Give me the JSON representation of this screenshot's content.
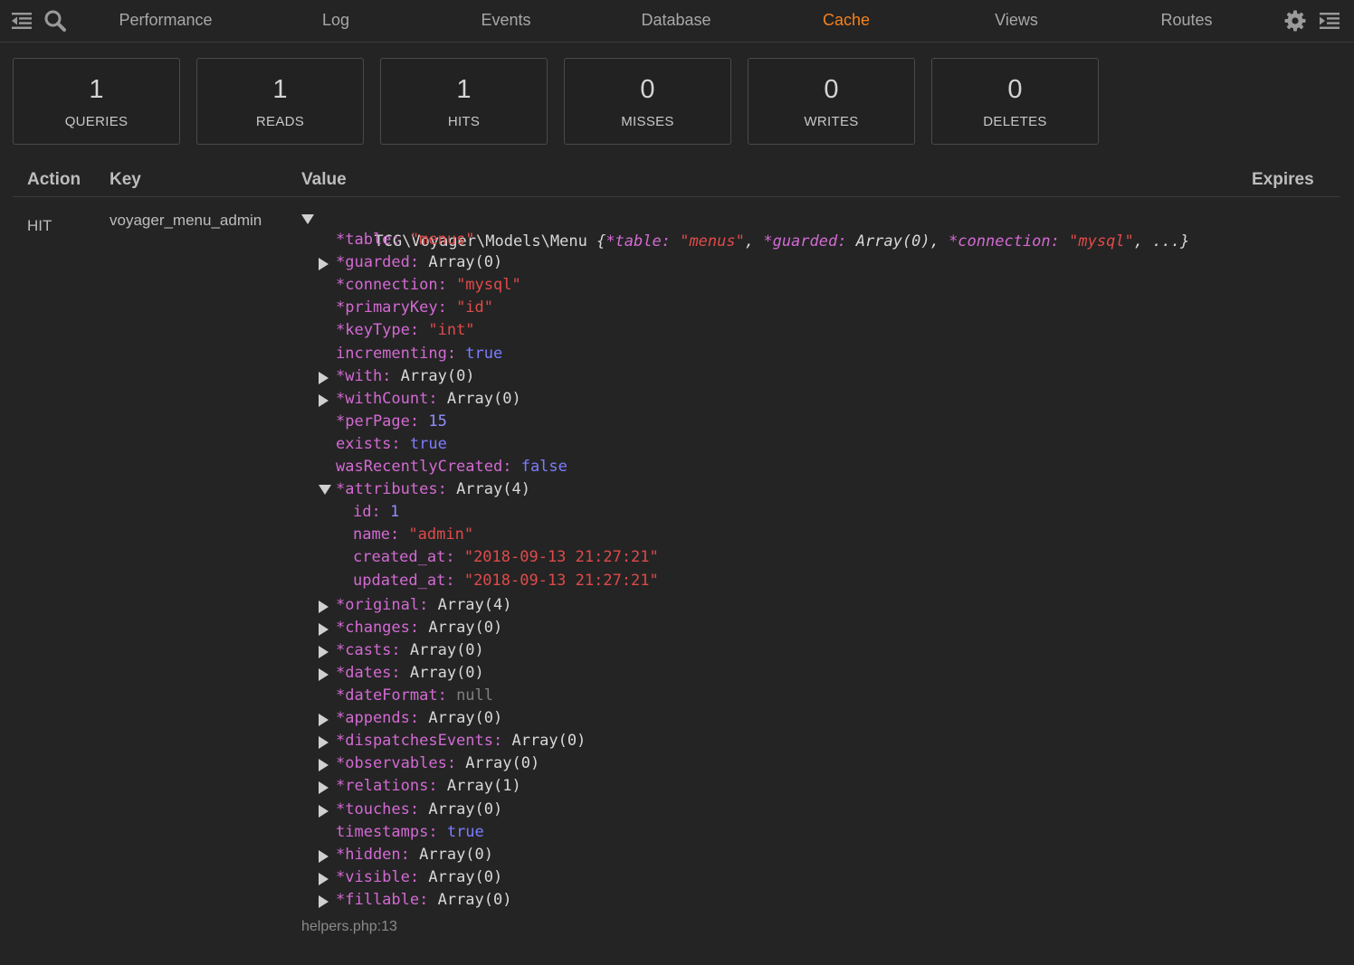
{
  "nav": {
    "tabs": [
      "Performance",
      "Log",
      "Events",
      "Database",
      "Cache",
      "Views",
      "Routes"
    ],
    "active_tab": "Cache",
    "left_icons": [
      "collapse-icon",
      "search-icon"
    ],
    "right_icons": [
      "gear-icon",
      "expand-panel-icon"
    ]
  },
  "stats": [
    {
      "value": "1",
      "label": "QUERIES"
    },
    {
      "value": "1",
      "label": "READS"
    },
    {
      "value": "1",
      "label": "HITS"
    },
    {
      "value": "0",
      "label": "MISSES"
    },
    {
      "value": "0",
      "label": "WRITES"
    },
    {
      "value": "0",
      "label": "DELETES"
    }
  ],
  "table": {
    "headers": {
      "action": "Action",
      "key": "Key",
      "value": "Value",
      "expires": "Expires"
    },
    "row": {
      "action": "HIT",
      "key": "voyager_menu_admin",
      "source": "helpers.php:13"
    }
  },
  "dump": {
    "class_name": "TCG\\Voyager\\Models\\Menu",
    "summary": [
      {
        "t": "w",
        "s": " {"
      },
      {
        "t": "k",
        "s": "*table:"
      },
      {
        "t": "str",
        "s": " \"menus\""
      },
      {
        "t": "w",
        "s": ", "
      },
      {
        "t": "k",
        "s": "*guarded:"
      },
      {
        "t": "w",
        "s": " Array(0), "
      },
      {
        "t": "k",
        "s": "*connection:"
      },
      {
        "t": "str",
        "s": " \"mysql\""
      },
      {
        "t": "w",
        "s": ", ...}"
      }
    ],
    "lines": [
      {
        "indent": 1,
        "tri": "",
        "parts": [
          {
            "t": "k",
            "s": "*table:"
          },
          {
            "t": "str",
            "s": " \"menus\""
          }
        ]
      },
      {
        "indent": 1,
        "tri": "right",
        "parts": [
          {
            "t": "k",
            "s": "*guarded:"
          },
          {
            "t": "w",
            "s": " Array(0)"
          }
        ]
      },
      {
        "indent": 1,
        "tri": "",
        "parts": [
          {
            "t": "k",
            "s": "*connection:"
          },
          {
            "t": "str",
            "s": " \"mysql\""
          }
        ]
      },
      {
        "indent": 1,
        "tri": "",
        "parts": [
          {
            "t": "k",
            "s": "*primaryKey:"
          },
          {
            "t": "str",
            "s": " \"id\""
          }
        ]
      },
      {
        "indent": 1,
        "tri": "",
        "parts": [
          {
            "t": "k",
            "s": "*keyType:"
          },
          {
            "t": "str",
            "s": " \"int\""
          }
        ]
      },
      {
        "indent": 1,
        "tri": "",
        "parts": [
          {
            "t": "k",
            "s": "incrementing:"
          },
          {
            "t": "bool",
            "s": " true"
          }
        ]
      },
      {
        "indent": 1,
        "tri": "right",
        "parts": [
          {
            "t": "k",
            "s": "*with:"
          },
          {
            "t": "w",
            "s": " Array(0)"
          }
        ]
      },
      {
        "indent": 1,
        "tri": "right",
        "parts": [
          {
            "t": "k",
            "s": "*withCount:"
          },
          {
            "t": "w",
            "s": " Array(0)"
          }
        ]
      },
      {
        "indent": 1,
        "tri": "",
        "parts": [
          {
            "t": "k",
            "s": "*perPage:"
          },
          {
            "t": "num",
            "s": " 15"
          }
        ]
      },
      {
        "indent": 1,
        "tri": "",
        "parts": [
          {
            "t": "k",
            "s": "exists:"
          },
          {
            "t": "bool",
            "s": " true"
          }
        ]
      },
      {
        "indent": 1,
        "tri": "",
        "parts": [
          {
            "t": "k",
            "s": "wasRecentlyCreated:"
          },
          {
            "t": "bool",
            "s": " false"
          }
        ]
      },
      {
        "indent": 1,
        "tri": "down",
        "parts": [
          {
            "t": "k",
            "s": "*attributes:"
          },
          {
            "t": "w",
            "s": " Array(4)"
          }
        ]
      },
      {
        "indent": 2,
        "tri": "",
        "parts": [
          {
            "t": "k",
            "s": "id:"
          },
          {
            "t": "num",
            "s": " 1"
          }
        ]
      },
      {
        "indent": 2,
        "tri": "",
        "parts": [
          {
            "t": "k",
            "s": "name:"
          },
          {
            "t": "str",
            "s": " \"admin\""
          }
        ]
      },
      {
        "indent": 2,
        "tri": "",
        "parts": [
          {
            "t": "k",
            "s": "created_at:"
          },
          {
            "t": "str",
            "s": " \"2018-09-13 21:27:21\""
          }
        ]
      },
      {
        "indent": 2,
        "tri": "",
        "parts": [
          {
            "t": "k",
            "s": "updated_at:"
          },
          {
            "t": "str",
            "s": " \"2018-09-13 21:27:21\""
          }
        ]
      },
      {
        "indent": 1,
        "tri": "right",
        "parts": [
          {
            "t": "k",
            "s": "*original:"
          },
          {
            "t": "w",
            "s": " Array(4)"
          }
        ]
      },
      {
        "indent": 1,
        "tri": "right",
        "parts": [
          {
            "t": "k",
            "s": "*changes:"
          },
          {
            "t": "w",
            "s": " Array(0)"
          }
        ]
      },
      {
        "indent": 1,
        "tri": "right",
        "parts": [
          {
            "t": "k",
            "s": "*casts:"
          },
          {
            "t": "w",
            "s": " Array(0)"
          }
        ]
      },
      {
        "indent": 1,
        "tri": "right",
        "parts": [
          {
            "t": "k",
            "s": "*dates:"
          },
          {
            "t": "w",
            "s": " Array(0)"
          }
        ]
      },
      {
        "indent": 1,
        "tri": "",
        "parts": [
          {
            "t": "k",
            "s": "*dateFormat:"
          },
          {
            "t": "nul",
            "s": " null"
          }
        ]
      },
      {
        "indent": 1,
        "tri": "right",
        "parts": [
          {
            "t": "k",
            "s": "*appends:"
          },
          {
            "t": "w",
            "s": " Array(0)"
          }
        ]
      },
      {
        "indent": 1,
        "tri": "right",
        "parts": [
          {
            "t": "k",
            "s": "*dispatchesEvents:"
          },
          {
            "t": "w",
            "s": " Array(0)"
          }
        ]
      },
      {
        "indent": 1,
        "tri": "right",
        "parts": [
          {
            "t": "k",
            "s": "*observables:"
          },
          {
            "t": "w",
            "s": " Array(0)"
          }
        ]
      },
      {
        "indent": 1,
        "tri": "right",
        "parts": [
          {
            "t": "k",
            "s": "*relations:"
          },
          {
            "t": "w",
            "s": " Array(1)"
          }
        ]
      },
      {
        "indent": 1,
        "tri": "right",
        "parts": [
          {
            "t": "k",
            "s": "*touches:"
          },
          {
            "t": "w",
            "s": " Array(0)"
          }
        ]
      },
      {
        "indent": 1,
        "tri": "",
        "parts": [
          {
            "t": "k",
            "s": "timestamps:"
          },
          {
            "t": "bool",
            "s": " true"
          }
        ]
      },
      {
        "indent": 1,
        "tri": "right",
        "parts": [
          {
            "t": "k",
            "s": "*hidden:"
          },
          {
            "t": "w",
            "s": " Array(0)"
          }
        ]
      },
      {
        "indent": 1,
        "tri": "right",
        "parts": [
          {
            "t": "k",
            "s": "*visible:"
          },
          {
            "t": "w",
            "s": " Array(0)"
          }
        ]
      },
      {
        "indent": 1,
        "tri": "right",
        "parts": [
          {
            "t": "k",
            "s": "*fillable:"
          },
          {
            "t": "w",
            "s": " Array(0)"
          }
        ]
      }
    ]
  },
  "colors": {
    "background": "#242424",
    "accent_active_tab": "#f5821f",
    "dump_key": "#d36ad3",
    "dump_string": "#e04a4a",
    "dump_number": "#8f8fff",
    "dump_null": "#808080"
  }
}
